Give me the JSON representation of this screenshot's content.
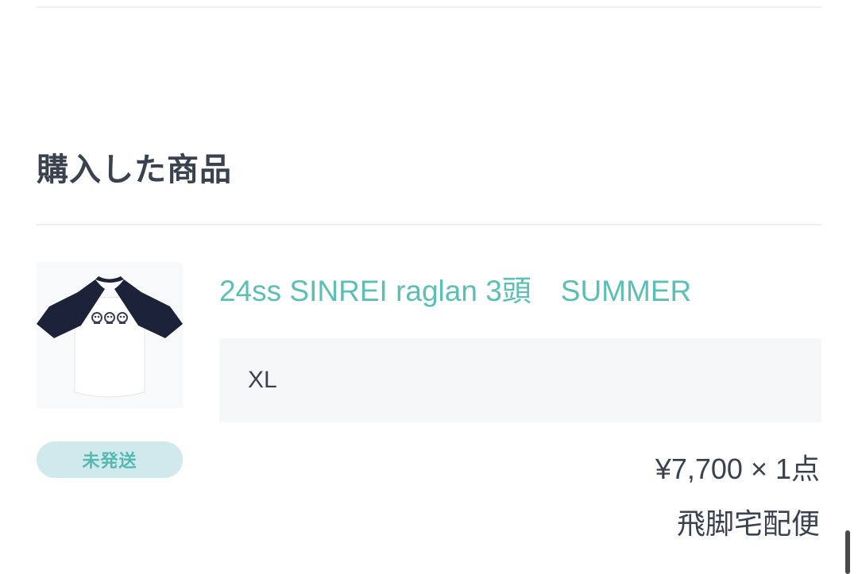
{
  "section": {
    "title": "購入した商品"
  },
  "item": {
    "name": "24ss SINREI raglan 3頭　SUMMER",
    "variant": "XL",
    "status": "未発送",
    "price_quantity": "¥7,700 × 1点",
    "shipping_method": "飛脚宅配便",
    "image_icon": "raglan-tshirt-icon"
  },
  "colors": {
    "accent": "#5bbfb5",
    "badge_bg": "#cfe9ec",
    "badge_text": "#55b8b2",
    "text": "#3a4250",
    "variant_bg": "#f6f7f9",
    "shirt_sleeves": "#1c2237"
  }
}
